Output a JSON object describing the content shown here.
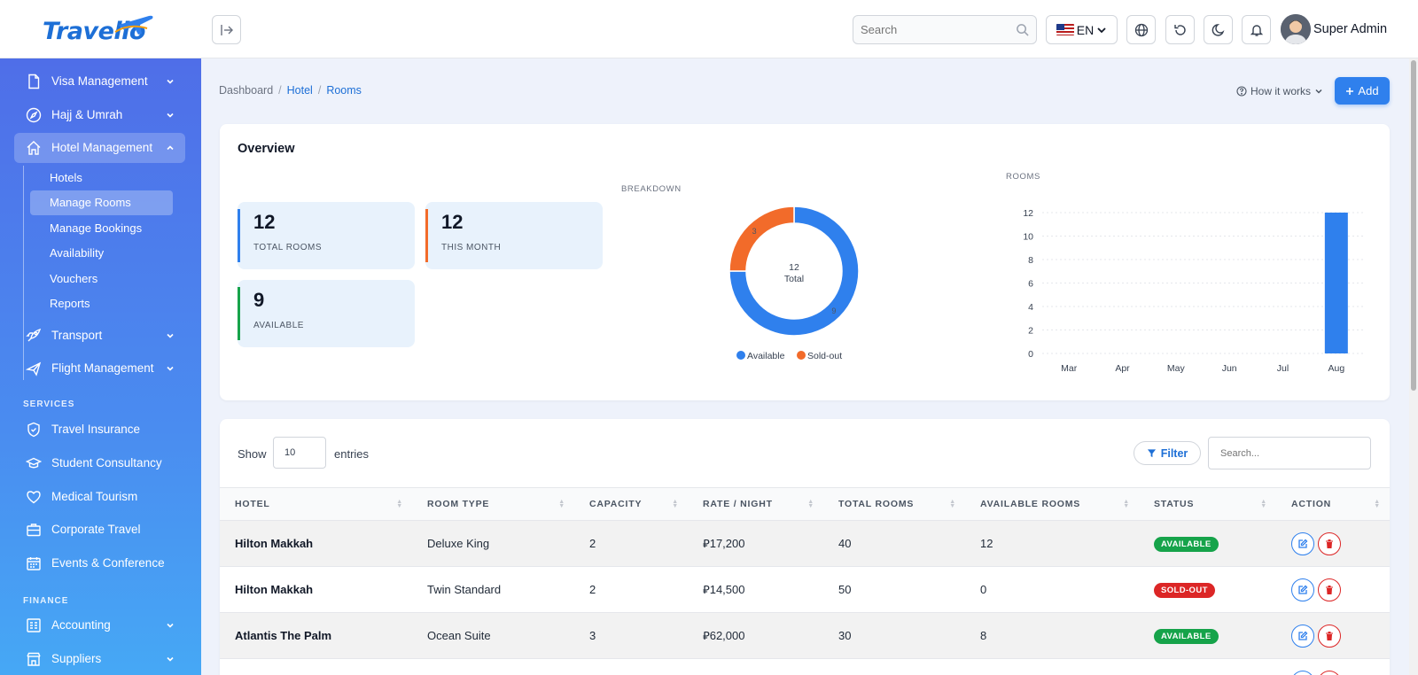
{
  "app": {
    "logo_text": "Travelio"
  },
  "header": {
    "search_placeholder": "Search",
    "language": "EN",
    "user_name": "Super Admin"
  },
  "sidebar": {
    "items": [
      {
        "label": "Visa Management",
        "icon": "document-icon"
      },
      {
        "label": "Hajj & Umrah",
        "icon": "compass-icon"
      },
      {
        "label": "Hotel Management",
        "icon": "home-icon"
      },
      {
        "label": "Transport",
        "icon": "rocket-icon"
      },
      {
        "label": "Flight Management",
        "icon": "plane-icon"
      }
    ],
    "hotel_sub": [
      "Hotels",
      "Manage Rooms",
      "Manage Bookings",
      "Availability",
      "Vouchers",
      "Reports"
    ],
    "services_heading": "SERVICES",
    "services": [
      {
        "label": "Travel Insurance",
        "icon": "shield-icon"
      },
      {
        "label": "Student Consultancy",
        "icon": "graduation-cap-icon"
      },
      {
        "label": "Medical Tourism",
        "icon": "heart-icon"
      },
      {
        "label": "Corporate Travel",
        "icon": "briefcase-icon"
      },
      {
        "label": "Events & Conference",
        "icon": "calendar-icon"
      }
    ],
    "finance_heading": "FINANCE",
    "finance": [
      {
        "label": "Accounting",
        "icon": "ledger-icon"
      },
      {
        "label": "Suppliers",
        "icon": "store-icon"
      }
    ]
  },
  "breadcrumb": {
    "root": "Dashboard",
    "section": "Hotel",
    "current": "Rooms",
    "sep": "/"
  },
  "toolbar": {
    "how_it_works": "How it works",
    "add_label": "Add"
  },
  "overview": {
    "title": "Overview",
    "stats": [
      {
        "value": "12",
        "label": "TOTAL ROOMS",
        "color": "#2f80ed"
      },
      {
        "value": "12",
        "label": "THIS MONTH",
        "color": "#f26b2a"
      },
      {
        "value": "9",
        "label": "AVAILABLE",
        "color": "#16a34a"
      }
    ],
    "breakdown_title": "BREAKDOWN",
    "rooms_title": "ROOMS"
  },
  "chart_data": [
    {
      "type": "pie",
      "title": "BREAKDOWN",
      "categories": [
        "Available",
        "Sold-out"
      ],
      "values": [
        9,
        3
      ],
      "colors": [
        "#2f80ed",
        "#f26b2a"
      ],
      "center_value": "12",
      "center_label": "Total",
      "legend": "bottom"
    },
    {
      "type": "bar",
      "title": "ROOMS",
      "categories": [
        "Mar",
        "Apr",
        "May",
        "Jun",
        "Jul",
        "Aug"
      ],
      "values": [
        0,
        0,
        0,
        0,
        0,
        12
      ],
      "ylim": [
        0,
        12
      ],
      "yticks": [
        0,
        2,
        4,
        6,
        8,
        10,
        12
      ],
      "color": "#2f80ed",
      "grid": true
    }
  ],
  "table": {
    "show_label": "Show",
    "entries_value": "10",
    "entries_label": "entries",
    "filter_label": "Filter",
    "search_placeholder": "Search...",
    "columns": [
      "HOTEL",
      "ROOM TYPE",
      "CAPACITY",
      "RATE / NIGHT",
      "TOTAL ROOMS",
      "AVAILABLE ROOMS",
      "STATUS",
      "ACTION"
    ],
    "rows": [
      {
        "hotel": "Hilton Makkah",
        "room_type": "Deluxe King",
        "capacity": "2",
        "rate": "⃁17,200",
        "total": "40",
        "available": "12",
        "status": "AVAILABLE",
        "status_color": "#16a34a"
      },
      {
        "hotel": "Hilton Makkah",
        "room_type": "Twin Standard",
        "capacity": "2",
        "rate": "⃁14,500",
        "total": "50",
        "available": "0",
        "status": "SOLD-OUT",
        "status_color": "#dc2626"
      },
      {
        "hotel": "Atlantis The Palm",
        "room_type": "Ocean Suite",
        "capacity": "3",
        "rate": "⃁62,000",
        "total": "30",
        "available": "8",
        "status": "AVAILABLE",
        "status_color": "#16a34a"
      },
      {
        "hotel": "",
        "room_type": "",
        "capacity": "",
        "rate": "",
        "total": "",
        "available": "",
        "status": "",
        "status_color": "#16a34a"
      }
    ]
  },
  "colors": {
    "accent": "#2f80ed",
    "danger": "#dc2626",
    "success": "#16a34a",
    "orange": "#f26b2a"
  }
}
